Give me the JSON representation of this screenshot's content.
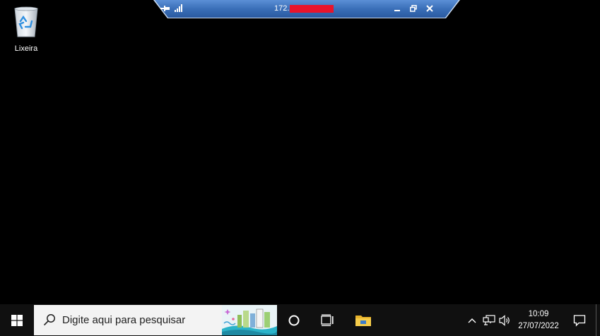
{
  "desktop": {
    "icons": [
      {
        "label": "Lixeira",
        "icon": "recycle-bin-icon"
      }
    ]
  },
  "rdp_bar": {
    "title_prefix": "172.",
    "title_redacted": true,
    "pin_icon": "pin-icon",
    "signal_icon": "connection-signal-icon",
    "controls": [
      "minimize-icon",
      "restore-icon",
      "close-icon"
    ]
  },
  "taskbar": {
    "search": {
      "placeholder": "Digite aqui para pesquisar"
    },
    "clock": {
      "time": "10:09",
      "date": "27/07/2022"
    },
    "colors": {
      "taskbar_bg": "#101010",
      "search_bg": "#f3f3f3",
      "rdp_bar": "#3a6fb8"
    }
  }
}
